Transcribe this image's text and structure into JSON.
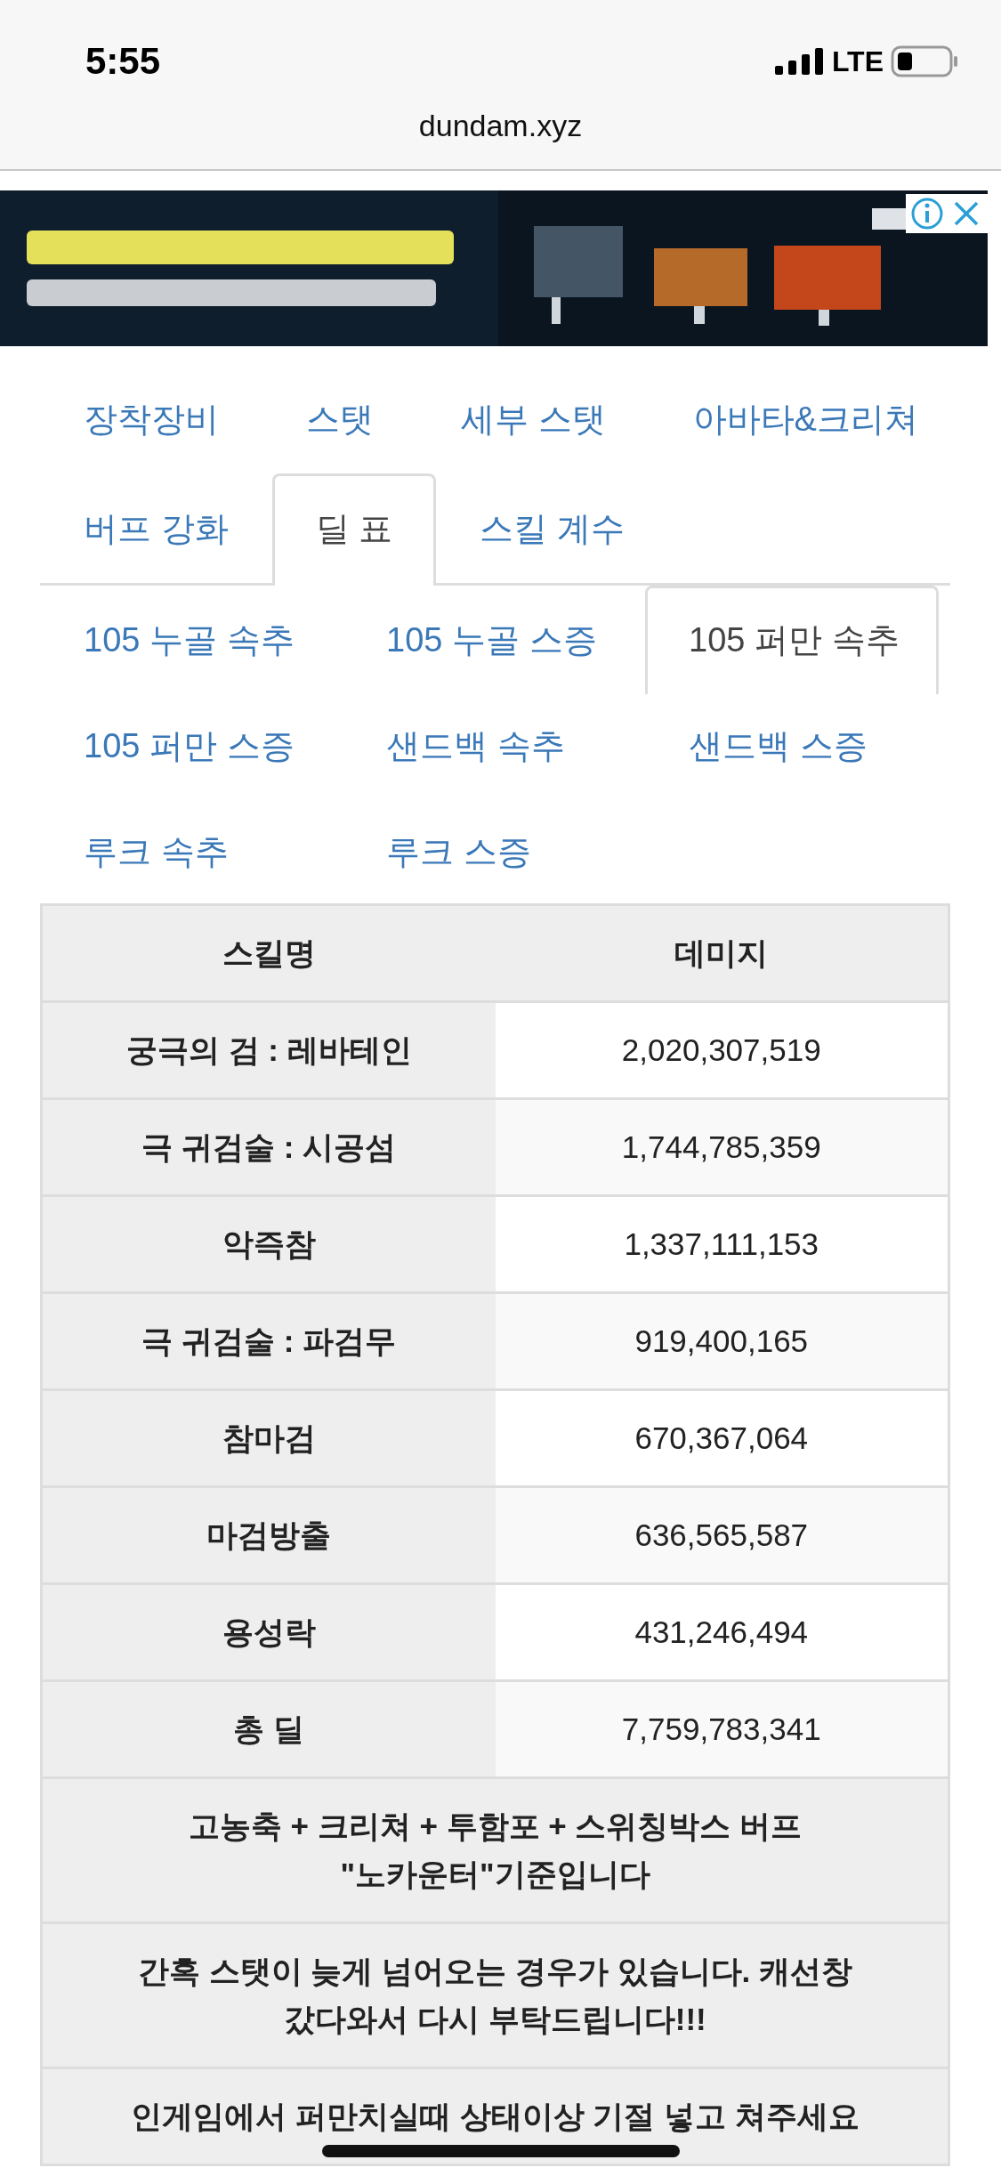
{
  "status_bar": {
    "time": "5:55",
    "network": "LTE"
  },
  "browser": {
    "url": "dundam.xyz"
  },
  "tabs": [
    {
      "label": "장착장비",
      "selected": false
    },
    {
      "label": "스탯",
      "selected": false
    },
    {
      "label": "세부 스탯",
      "selected": false
    },
    {
      "label": "아바타&크리쳐",
      "selected": false
    },
    {
      "label": "버프 강화",
      "selected": false
    },
    {
      "label": "딜 표",
      "selected": true
    },
    {
      "label": "스킬 계수",
      "selected": false
    }
  ],
  "sub_tabs": [
    {
      "label": "105 누골 속추",
      "selected": false
    },
    {
      "label": "105 누골 스증",
      "selected": false
    },
    {
      "label": "105 퍼만 속추",
      "selected": true
    },
    {
      "label": "105 퍼만 스증",
      "selected": false
    },
    {
      "label": "샌드백 속추",
      "selected": false
    },
    {
      "label": "샌드백 스증",
      "selected": false
    },
    {
      "label": "루크 속추",
      "selected": false
    },
    {
      "label": "루크 스증",
      "selected": false
    }
  ],
  "table": {
    "columns": [
      "스킬명",
      "데미지"
    ],
    "rows": [
      {
        "skill": "궁극의 검 : 레바테인",
        "damage": "2,020,307,519"
      },
      {
        "skill": "극 귀검술 : 시공섬",
        "damage": "1,744,785,359"
      },
      {
        "skill": "악즉참",
        "damage": "1,337,111,153"
      },
      {
        "skill": "극 귀검술 : 파검무",
        "damage": "919,400,165"
      },
      {
        "skill": "참마검",
        "damage": "670,367,064"
      },
      {
        "skill": "마검방출",
        "damage": "636,565,587"
      },
      {
        "skill": "용성락",
        "damage": "431,246,494"
      },
      {
        "skill": "총 딜",
        "damage": "7,759,783,341"
      }
    ],
    "notes": [
      "고농축 + 크리쳐 + 투함포 + 스위칭박스 버프 \"노카운터\"기준입니다",
      "간혹 스탯이 늦게 넘어오는 경우가 있습니다. 캐선창 갔다와서 다시 부탁드립니다!!!",
      "인게임에서 퍼만치실때 상태이상 기절 넣고 쳐주세요"
    ]
  }
}
